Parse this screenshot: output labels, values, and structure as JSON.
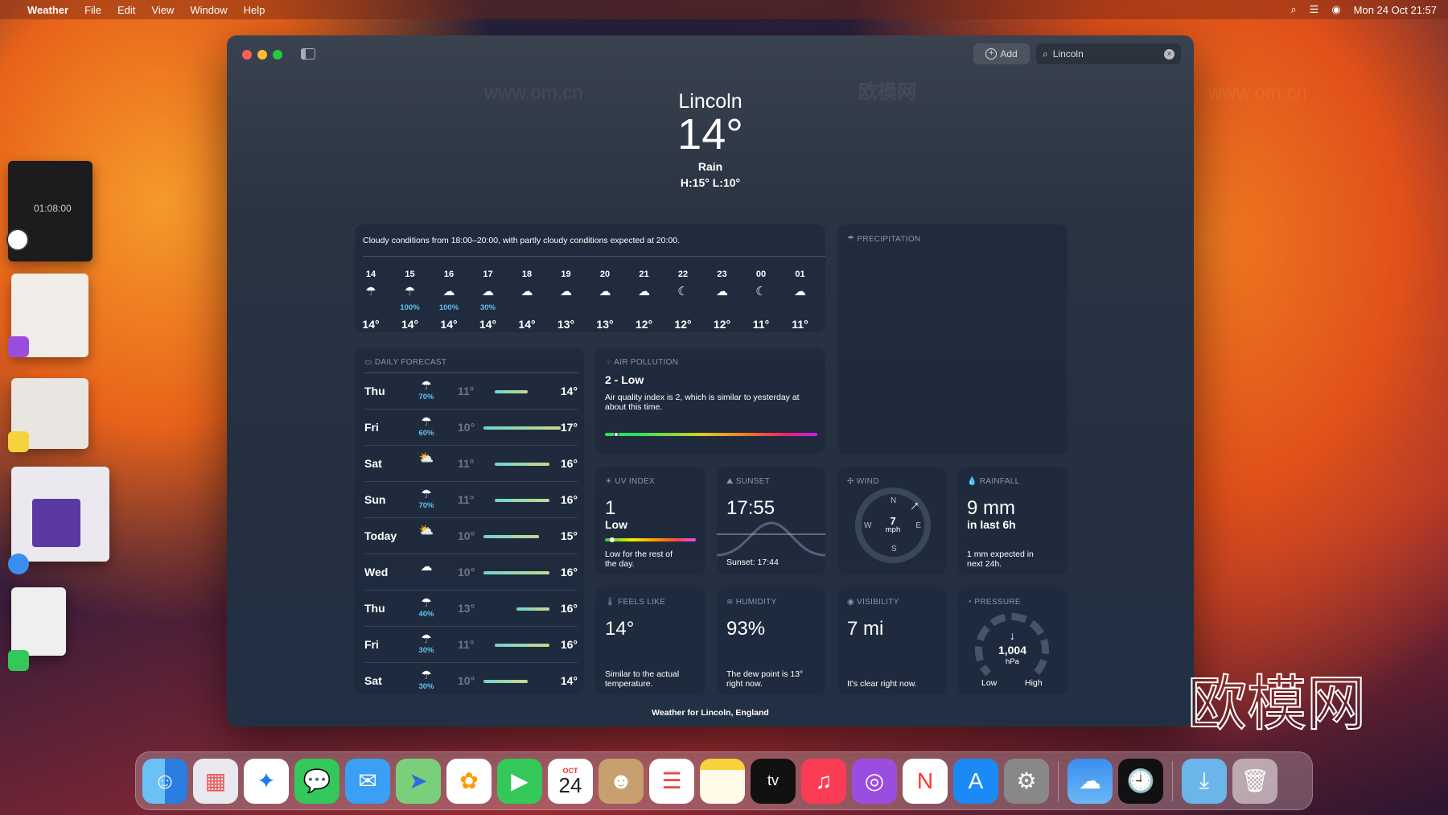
{
  "menubar": {
    "app": "Weather",
    "items": [
      "File",
      "Edit",
      "View",
      "Window",
      "Help"
    ],
    "clock": "Mon 24 Oct  21:57"
  },
  "toolbar": {
    "add_label": "Add",
    "search_value": "Lincoln"
  },
  "current": {
    "city": "Lincoln",
    "temp": "14°",
    "condition": "Rain",
    "hilo": "H:15°  L:10°"
  },
  "hourly": {
    "summary": "Cloudy conditions from 18:00–20:00, with partly cloudy conditions expected at 20:00.",
    "hours": [
      {
        "t": "14",
        "icon": "rain",
        "p": "",
        "v": "14°"
      },
      {
        "t": "15",
        "icon": "rain",
        "p": "100%",
        "v": "14°"
      },
      {
        "t": "16",
        "icon": "night-rain",
        "p": "100%",
        "v": "14°"
      },
      {
        "t": "17",
        "icon": "night-rain",
        "p": "30%",
        "v": "14°"
      },
      {
        "t": "18",
        "icon": "cloud",
        "p": "",
        "v": "14°"
      },
      {
        "t": "19",
        "icon": "cloud",
        "p": "",
        "v": "13°"
      },
      {
        "t": "20",
        "icon": "partly-cloudy-night",
        "p": "",
        "v": "13°"
      },
      {
        "t": "21",
        "icon": "partly-cloudy-night",
        "p": "",
        "v": "12°"
      },
      {
        "t": "22",
        "icon": "moon",
        "p": "",
        "v": "12°"
      },
      {
        "t": "23",
        "icon": "partly-cloudy-night",
        "p": "",
        "v": "12°"
      },
      {
        "t": "00",
        "icon": "moon",
        "p": "",
        "v": "11°"
      },
      {
        "t": "01",
        "icon": "partly-cloudy-night",
        "p": "",
        "v": "11°"
      }
    ]
  },
  "precipitation": {
    "label": "PRECIPITATION"
  },
  "daily": {
    "label": "DAILY FORECAST",
    "range": [
      10,
      17
    ],
    "days": [
      {
        "d": "Thu",
        "icon": "rain",
        "p": "70%",
        "lo": 11,
        "hi": 14,
        "lo_t": "11°",
        "hi_t": "14°"
      },
      {
        "d": "Fri",
        "icon": "rain",
        "p": "60%",
        "lo": 10,
        "hi": 17,
        "lo_t": "10°",
        "hi_t": "17°"
      },
      {
        "d": "Sat",
        "icon": "partly-sunny",
        "p": "",
        "lo": 11,
        "hi": 16,
        "lo_t": "11°",
        "hi_t": "16°"
      },
      {
        "d": "Sun",
        "icon": "rain",
        "p": "70%",
        "lo": 11,
        "hi": 16,
        "lo_t": "11°",
        "hi_t": "16°"
      },
      {
        "d": "Today",
        "icon": "partly-sunny",
        "p": "",
        "lo": 10,
        "hi": 15,
        "lo_t": "10°",
        "hi_t": "15°"
      },
      {
        "d": "Wed",
        "icon": "cloud",
        "p": "",
        "lo": 10,
        "hi": 16,
        "lo_t": "10°",
        "hi_t": "16°"
      },
      {
        "d": "Thu",
        "icon": "rain",
        "p": "40%",
        "lo": 13,
        "hi": 16,
        "lo_t": "13°",
        "hi_t": "16°"
      },
      {
        "d": "Fri",
        "icon": "rain",
        "p": "30%",
        "lo": 11,
        "hi": 16,
        "lo_t": "11°",
        "hi_t": "16°"
      },
      {
        "d": "Sat",
        "icon": "rain",
        "p": "30%",
        "lo": 10,
        "hi": 14,
        "lo_t": "10°",
        "hi_t": "14°"
      }
    ]
  },
  "air": {
    "label": "AIR POLLUTION",
    "value": "2 - Low",
    "desc": "Air quality index is 2, which is similar to yesterday at about this time.",
    "level_fraction": 0.04
  },
  "uv": {
    "label": "UV INDEX",
    "value": "1",
    "level": "Low",
    "desc": "Low for the rest of the day.",
    "level_fraction": 0.05
  },
  "sunset": {
    "label": "SUNSET",
    "value": "17:55",
    "sub": "Sunset: 17:44"
  },
  "wind": {
    "label": "WIND",
    "speed": "7",
    "unit": "mph",
    "n": "N",
    "e": "E",
    "s": "S",
    "w": "W"
  },
  "rainfall": {
    "label": "RAINFALL",
    "value": "9 mm",
    "sub": "in last 6h",
    "desc": "1 mm expected in next 24h."
  },
  "feels": {
    "label": "FEELS LIKE",
    "value": "14°",
    "desc": "Similar to the actual temperature."
  },
  "humidity": {
    "label": "HUMIDITY",
    "value": "93%",
    "desc": "The dew point is 13° right now."
  },
  "visibility": {
    "label": "VISIBILITY",
    "value": "7 mi",
    "desc": "It's clear right now."
  },
  "pressure": {
    "label": "PRESSURE",
    "value": "1,004",
    "unit": "hPa",
    "low": "Low",
    "high": "High"
  },
  "footer": "Weather for Lincoln, England",
  "stage": {
    "clock_time": "01:08:00"
  },
  "dock": {
    "calendar_month": "OCT",
    "calendar_day": "24"
  },
  "watermark": {
    "big": "欧模网",
    "site": "www.om.cn"
  },
  "colors": {
    "accent_precip": "#5ec3f0",
    "card": "#1e2a3c"
  }
}
